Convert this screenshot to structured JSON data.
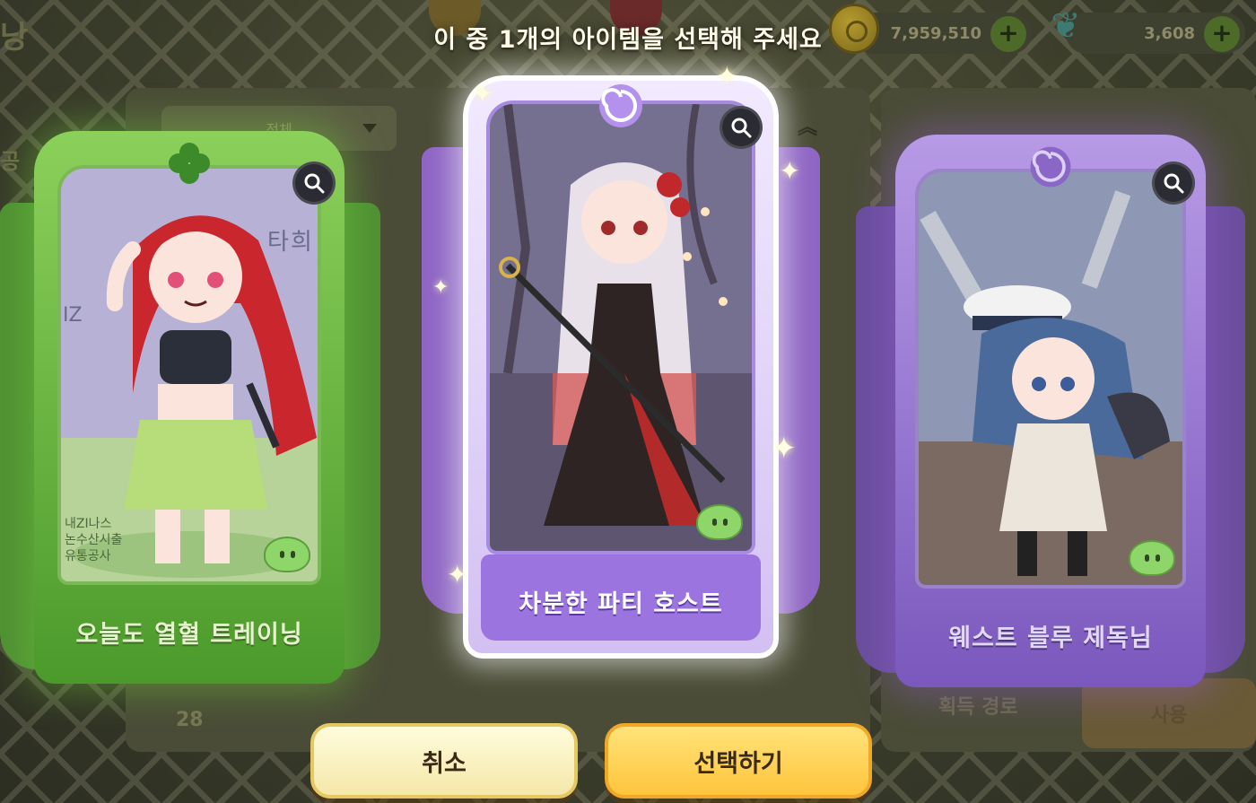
{
  "prompt": "이 중 1개의 아이템을 선택해 주세요",
  "currency": {
    "gold": {
      "amount": "7,959,510",
      "icon": "coin-icon"
    },
    "gem": {
      "amount": "3,608",
      "icon": "butterfly-icon"
    },
    "plus_symbol": "+"
  },
  "background": {
    "title_fragment": "낭",
    "side_label_fragment": "공",
    "dropdown_label": "전체",
    "scroll_up_symbol": "︽",
    "count": "28",
    "route_label": "획득 경로",
    "use_button_label": "사용"
  },
  "cards": [
    {
      "name": "오늘도 열혈 트레이닝",
      "emblem": "clover-icon",
      "theme": "green",
      "background_text": [
        "타",
        "IZ",
        "희",
        "내ZI나스",
        "논수산시출",
        "유통공사"
      ]
    },
    {
      "name": "차분한 파티 호스트",
      "emblem": "swirl-icon",
      "theme": "purple",
      "selected": true
    },
    {
      "name": "웨스트 블루 제독님",
      "emblem": "swirl-icon",
      "theme": "purple"
    }
  ],
  "buttons": {
    "cancel": "취소",
    "select": "선택하기"
  },
  "colors": {
    "green_card": "#6fb846",
    "purple_card": "#9c74e0",
    "confirm_button": "#ffc43c",
    "cancel_button": "#fff6c8"
  }
}
